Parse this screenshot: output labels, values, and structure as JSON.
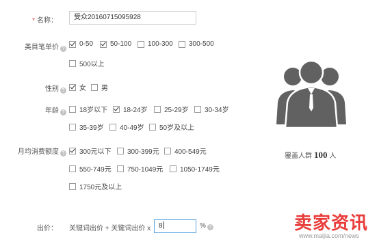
{
  "form": {
    "name": {
      "required_mark": "*",
      "label": "名称：",
      "value": "受众20160715095928"
    },
    "category_price": {
      "label": "类目笔单价",
      "options": [
        {
          "label": "0-50",
          "checked": true
        },
        {
          "label": "50-100",
          "checked": true
        },
        {
          "label": "100-300",
          "checked": false
        },
        {
          "label": "300-500",
          "checked": false
        },
        {
          "label": "500以上",
          "checked": false
        }
      ]
    },
    "gender": {
      "label": "性别",
      "options": [
        {
          "label": "女",
          "checked": true
        },
        {
          "label": "男",
          "checked": false
        }
      ]
    },
    "age": {
      "label": "年龄",
      "options": [
        {
          "label": "18岁以下",
          "checked": false
        },
        {
          "label": "18-24岁",
          "checked": true
        },
        {
          "label": "25-29岁",
          "checked": false
        },
        {
          "label": "30-34岁",
          "checked": false
        },
        {
          "label": "35-39岁",
          "checked": false
        },
        {
          "label": "40-49岁",
          "checked": false
        },
        {
          "label": "50岁及以上",
          "checked": false
        }
      ]
    },
    "monthly_spend": {
      "label": "月均消费额度",
      "options": [
        {
          "label": "300元以下",
          "checked": true
        },
        {
          "label": "300-399元",
          "checked": false
        },
        {
          "label": "400-549元",
          "checked": false
        },
        {
          "label": "550-749元",
          "checked": false
        },
        {
          "label": "750-1049元",
          "checked": false
        },
        {
          "label": "1050-1749元",
          "checked": false
        },
        {
          "label": "1750元及以上",
          "checked": false
        }
      ]
    },
    "bid": {
      "label": "出价：",
      "formula": "关键词出价 + 关键词出价 x",
      "value": "8",
      "unit": "%"
    }
  },
  "audience": {
    "prefix": "覆盖人群",
    "count": "100",
    "suffix": "人",
    "icon": "people-group-icon"
  },
  "help_icon_glyph": "?",
  "watermark": {
    "text": "卖家资讯",
    "url": "www.maijia.com/news"
  },
  "colors": {
    "required": "#ee3333",
    "icon": "#616161",
    "input_focus": "#59a3e0",
    "watermark": "#e83d3a"
  }
}
